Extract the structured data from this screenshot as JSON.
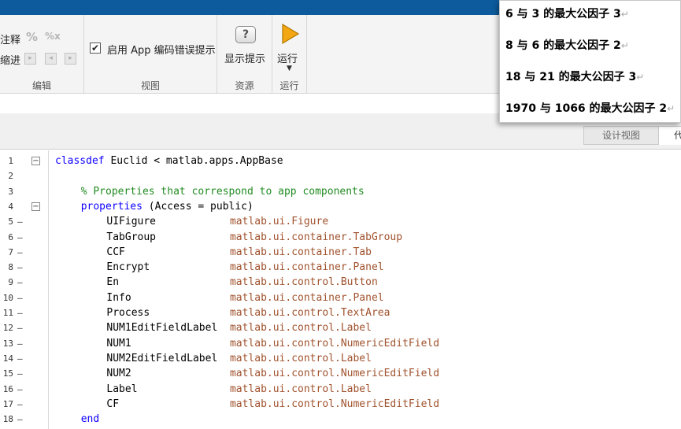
{
  "toolstrip": {
    "comment_label": "注释",
    "indent_label": "缩进",
    "edit_section": "编辑",
    "enable_app_label": "启用 App 编码错误提示",
    "view_section": "视图",
    "show_hints_label": "显示提示",
    "resources_section": "资源",
    "run_label": "运行",
    "run_section": "运行"
  },
  "editor_tabs": {
    "design": "设计视图",
    "code": "代码视图"
  },
  "code_lines": [
    {
      "ln": "1",
      "dash": "",
      "fold": "⊟",
      "indent": 0,
      "parts": [
        [
          "kw",
          "classdef"
        ],
        [
          "plain",
          " Euclid < matlab.apps.AppBase"
        ]
      ]
    },
    {
      "ln": "2",
      "dash": "",
      "fold": "",
      "indent": 0,
      "parts": []
    },
    {
      "ln": "3",
      "dash": "",
      "fold": "",
      "indent": 1,
      "parts": [
        [
          "cm",
          "% Properties that correspond to app components"
        ]
      ]
    },
    {
      "ln": "4",
      "dash": "",
      "fold": "⊟",
      "indent": 1,
      "parts": [
        [
          "kw",
          "properties"
        ],
        [
          "plain",
          " (Access = public)"
        ]
      ]
    },
    {
      "ln": "5",
      "dash": "–",
      "fold": "",
      "indent": 2,
      "parts": [
        [
          "plain",
          "UIFigure            "
        ],
        [
          "tp",
          "matlab.ui.Figure"
        ]
      ]
    },
    {
      "ln": "6",
      "dash": "–",
      "fold": "",
      "indent": 2,
      "parts": [
        [
          "plain",
          "TabGroup            "
        ],
        [
          "tp",
          "matlab.ui.container.TabGroup"
        ]
      ]
    },
    {
      "ln": "7",
      "dash": "–",
      "fold": "",
      "indent": 2,
      "parts": [
        [
          "plain",
          "CCF                 "
        ],
        [
          "tp",
          "matlab.ui.container.Tab"
        ]
      ]
    },
    {
      "ln": "8",
      "dash": "–",
      "fold": "",
      "indent": 2,
      "parts": [
        [
          "plain",
          "Encrypt             "
        ],
        [
          "tp",
          "matlab.ui.container.Panel"
        ]
      ]
    },
    {
      "ln": "9",
      "dash": "–",
      "fold": "",
      "indent": 2,
      "parts": [
        [
          "plain",
          "En                  "
        ],
        [
          "tp",
          "matlab.ui.control.Button"
        ]
      ]
    },
    {
      "ln": "10",
      "dash": "–",
      "fold": "",
      "indent": 2,
      "parts": [
        [
          "plain",
          "Info                "
        ],
        [
          "tp",
          "matlab.ui.container.Panel"
        ]
      ]
    },
    {
      "ln": "11",
      "dash": "–",
      "fold": "",
      "indent": 2,
      "parts": [
        [
          "plain",
          "Process             "
        ],
        [
          "tp",
          "matlab.ui.control.TextArea"
        ]
      ]
    },
    {
      "ln": "12",
      "dash": "–",
      "fold": "",
      "indent": 2,
      "parts": [
        [
          "plain",
          "NUM1EditFieldLabel  "
        ],
        [
          "tp",
          "matlab.ui.control.Label"
        ]
      ]
    },
    {
      "ln": "13",
      "dash": "–",
      "fold": "",
      "indent": 2,
      "parts": [
        [
          "plain",
          "NUM1                "
        ],
        [
          "tp",
          "matlab.ui.control.NumericEditField"
        ]
      ]
    },
    {
      "ln": "14",
      "dash": "–",
      "fold": "",
      "indent": 2,
      "parts": [
        [
          "plain",
          "NUM2EditFieldLabel  "
        ],
        [
          "tp",
          "matlab.ui.control.Label"
        ]
      ]
    },
    {
      "ln": "15",
      "dash": "–",
      "fold": "",
      "indent": 2,
      "parts": [
        [
          "plain",
          "NUM2                "
        ],
        [
          "tp",
          "matlab.ui.control.NumericEditField"
        ]
      ]
    },
    {
      "ln": "16",
      "dash": "–",
      "fold": "",
      "indent": 2,
      "parts": [
        [
          "plain",
          "Label               "
        ],
        [
          "tp",
          "matlab.ui.control.Label"
        ]
      ]
    },
    {
      "ln": "17",
      "dash": "–",
      "fold": "",
      "indent": 2,
      "parts": [
        [
          "plain",
          "CF                  "
        ],
        [
          "tp",
          "matlab.ui.control.NumericEditField"
        ]
      ]
    },
    {
      "ln": "18",
      "dash": "–",
      "fold": "",
      "indent": 1,
      "parts": [
        [
          "kw",
          "end"
        ]
      ]
    }
  ],
  "popup": {
    "lines": [
      "6 与 3 的最大公因子 3",
      "8 与 6 的最大公因子 2",
      "18 与 21 的最大公因子 3",
      "1970 与 1066 的最大公因子 2"
    ],
    "return_mark": "↵"
  },
  "colors": {
    "keyword": "#0e00ff",
    "comment": "#228b22",
    "type": "#a0522d",
    "titlebar": "#0d5a9c",
    "run_icon": "#f3a712"
  },
  "icons": {
    "checkbox": "✔",
    "hint": "?",
    "comment_percent": "%",
    "uncomment": "%x",
    "dropdown": "▼"
  }
}
